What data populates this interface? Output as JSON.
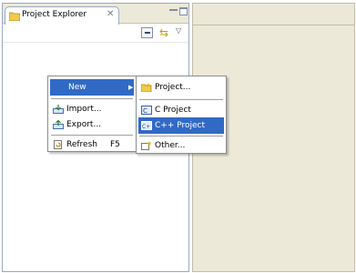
{
  "explorer": {
    "tab_label": "Project Explorer",
    "close_glyph": "✕"
  },
  "context_menu": {
    "items": [
      {
        "label": "New",
        "icon": "none",
        "selected": true,
        "has_submenu": true
      },
      {
        "label": "Import...",
        "icon": "import-icon"
      },
      {
        "label": "Export...",
        "icon": "export-icon"
      },
      {
        "label": "Refresh",
        "icon": "refresh-icon",
        "shortcut": "F5"
      }
    ]
  },
  "submenu": {
    "items": [
      {
        "label": "Project...",
        "icon": "project-icon"
      },
      {
        "label": "C Project",
        "icon": "c-project-icon"
      },
      {
        "label": "C++ Project",
        "icon": "cpp-project-icon",
        "selected": true
      },
      {
        "label": "Other...",
        "icon": "other-wizard-icon"
      }
    ]
  },
  "colors": {
    "selection": "#316ac5",
    "chrome": "#ece9d8",
    "border": "#99a8c3"
  }
}
